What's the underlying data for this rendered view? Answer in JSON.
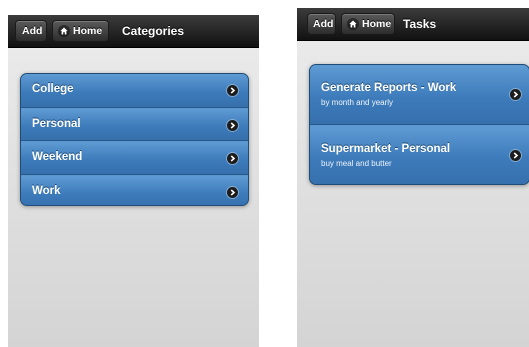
{
  "screens": [
    {
      "header": {
        "add_label": "Add",
        "home_label": "Home",
        "title": "Categories"
      },
      "items": [
        {
          "title": "College"
        },
        {
          "title": "Personal"
        },
        {
          "title": "Weekend"
        },
        {
          "title": "Work"
        }
      ]
    },
    {
      "header": {
        "add_label": "Add",
        "home_label": "Home",
        "title": "Tasks"
      },
      "items": [
        {
          "title": "Generate Reports - Work",
          "subtitle": "by month and yearly"
        },
        {
          "title": "Supermarket - Personal",
          "subtitle": "buy meal and butter"
        }
      ]
    }
  ],
  "colors": {
    "header": "#111111",
    "list_item": "#3d7bbb",
    "background": "#d4d4d4"
  },
  "icons": {
    "home": "home-icon",
    "arrow": "chevron-right-icon"
  }
}
